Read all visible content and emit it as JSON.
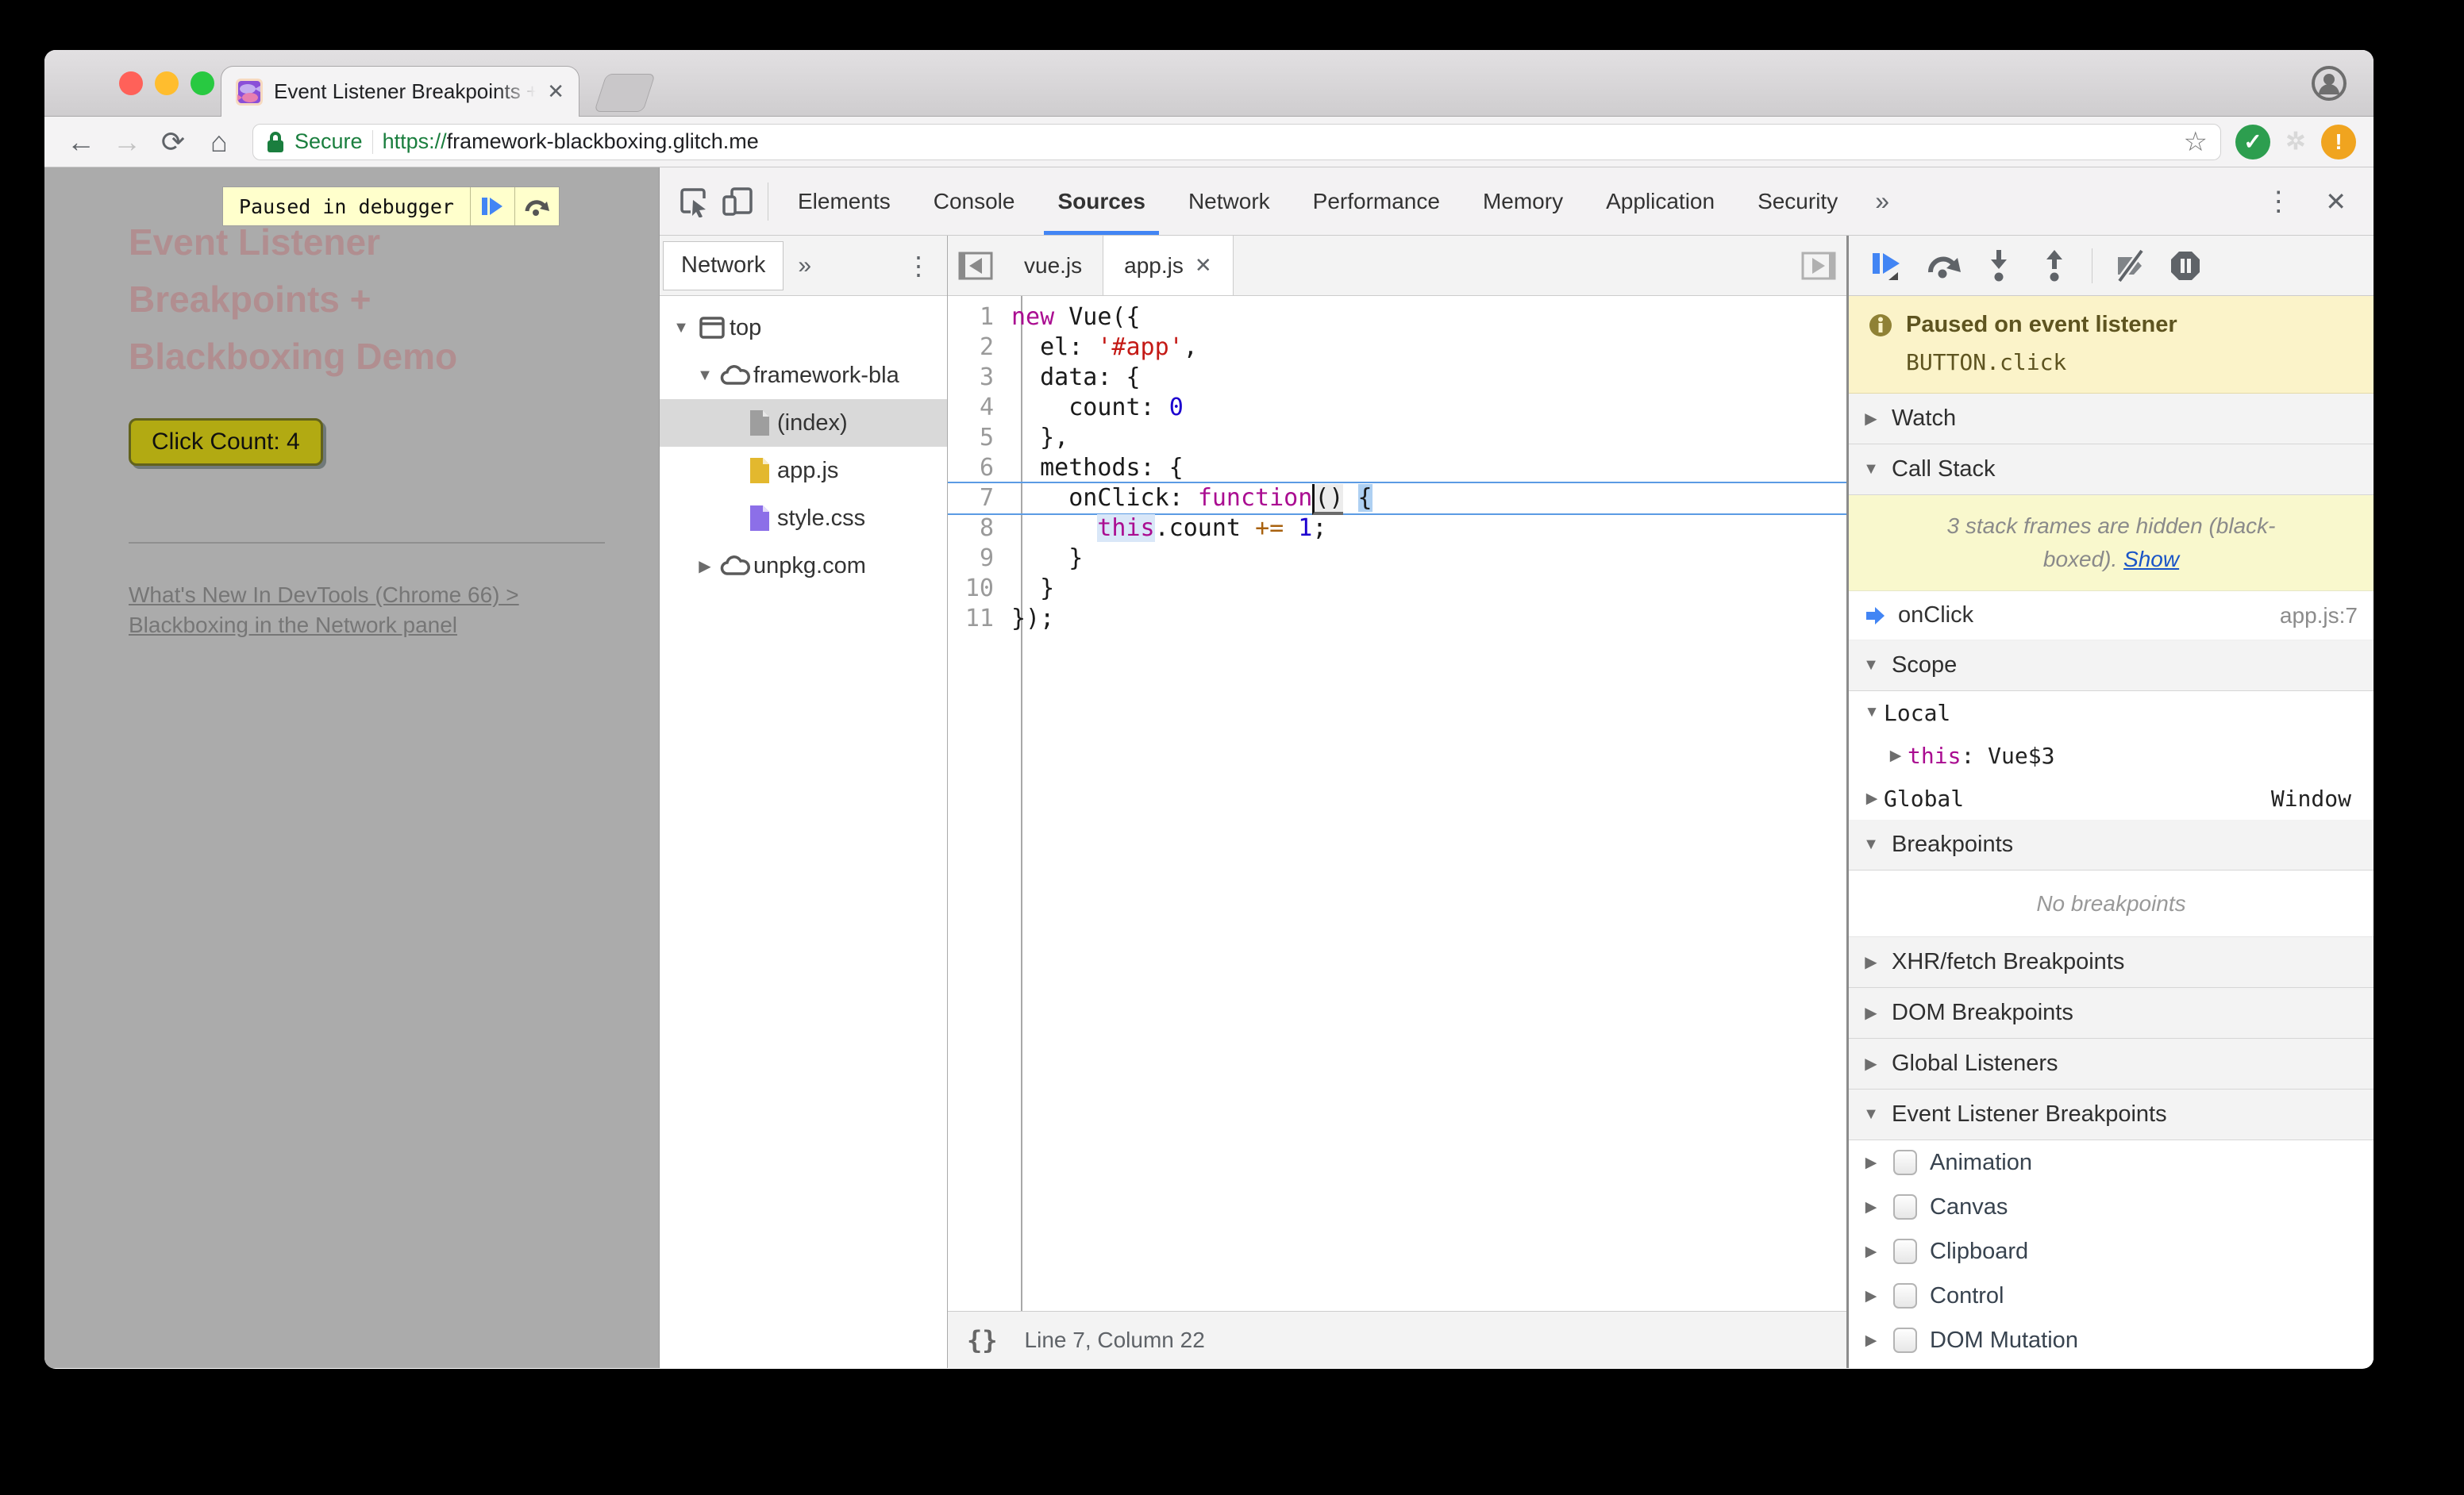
{
  "colors": {
    "accent_blue": "#4285f4",
    "exec_blue": "#5b9be4",
    "selection_blue": "#aed0f2",
    "token_hl_blue": "#d9e7f8",
    "paren_box_gray": "#ececec",
    "kw": "#aa0d91",
    "str": "#c41a16",
    "num": "#1c00cf",
    "op": "#a8610e",
    "paused_banner_bg": "#fbf3c9",
    "paused_banner_text": "#5e5420",
    "hidden_frames_bg": "#f9f8cd",
    "link_blue": "#1a55c7",
    "secure_green": "#1a7e3e",
    "page_bg": "#ababab",
    "page_title": "#b18e90",
    "page_button_bg": "#b2aa12",
    "ok_green": "#2d9e4f",
    "warn_orange": "#f0a41f"
  },
  "titlebar": {
    "tab_title": "Event Listener Breakpoints + B",
    "close_glyph": "✕"
  },
  "toolbar": {
    "secure_label": "Secure",
    "url_scheme": "https://",
    "url_host": "framework-blackboxing.glitch.me"
  },
  "page": {
    "paused_bar_label": "Paused in debugger",
    "title": "Event Listener\nBreakpoints +\nBlackboxing Demo",
    "button_label": "Click Count: 4",
    "link_text": "What's New In DevTools (Chrome 66) >\nBlackboxing in the Network panel"
  },
  "devtools": {
    "tabs": [
      {
        "label": "Elements",
        "active": false
      },
      {
        "label": "Console",
        "active": false
      },
      {
        "label": "Sources",
        "active": true
      },
      {
        "label": "Network",
        "active": false
      },
      {
        "label": "Performance",
        "active": false
      },
      {
        "label": "Memory",
        "active": false
      },
      {
        "label": "Application",
        "active": false
      },
      {
        "label": "Security",
        "active": false
      }
    ],
    "more_tabs_glyph": "»",
    "menu_glyph": "⋮",
    "close_glyph": "✕",
    "navigator": {
      "tab_label": "Network",
      "more_glyph": "»",
      "menu_glyph": "⋮",
      "tree": [
        {
          "indent": 0,
          "arrow": "▼",
          "icon": "frame",
          "label": "top",
          "selected": false
        },
        {
          "indent": 1,
          "arrow": "▼",
          "icon": "cloud",
          "label": "framework-bla",
          "selected": false
        },
        {
          "indent": 2,
          "arrow": "",
          "icon": "file-gray",
          "label": "(index)",
          "selected": true
        },
        {
          "indent": 2,
          "arrow": "",
          "icon": "file-yellow",
          "label": "app.js",
          "selected": false
        },
        {
          "indent": 2,
          "arrow": "",
          "icon": "file-purple",
          "label": "style.css",
          "selected": false
        },
        {
          "indent": 1,
          "arrow": "▶",
          "icon": "cloud",
          "label": "unpkg.com",
          "selected": false
        }
      ]
    },
    "editor": {
      "tabs": [
        {
          "label": "vue.js",
          "active": false,
          "closable": false
        },
        {
          "label": "app.js",
          "active": true,
          "closable": true
        }
      ],
      "close_glyph": "✕",
      "status": "Line 7, Column 22",
      "code": [
        {
          "n": "1",
          "exec": false,
          "tokens": [
            {
              "t": "new",
              "c": "kw"
            },
            {
              "t": " Vue({",
              "c": "pl"
            }
          ]
        },
        {
          "n": "2",
          "exec": false,
          "tokens": [
            {
              "t": "  el: ",
              "c": "pl"
            },
            {
              "t": "'#app'",
              "c": "str"
            },
            {
              "t": ",",
              "c": "pl"
            }
          ]
        },
        {
          "n": "3",
          "exec": false,
          "tokens": [
            {
              "t": "  data: {",
              "c": "pl"
            }
          ]
        },
        {
          "n": "4",
          "exec": false,
          "tokens": [
            {
              "t": "    count: ",
              "c": "pl"
            },
            {
              "t": "0",
              "c": "num"
            }
          ]
        },
        {
          "n": "5",
          "exec": false,
          "tokens": [
            {
              "t": "  },",
              "c": "pl"
            }
          ]
        },
        {
          "n": "6",
          "exec": false,
          "tokens": [
            {
              "t": "  methods: {",
              "c": "pl"
            }
          ]
        },
        {
          "n": "7",
          "exec": true,
          "tokens": [
            {
              "t": "    onClick: ",
              "c": "pl"
            },
            {
              "t": "function",
              "c": "kw"
            },
            {
              "t": "()",
              "c": "parenbox"
            },
            {
              "t": " ",
              "c": "pl"
            },
            {
              "t": "{",
              "c": "selbox"
            }
          ]
        },
        {
          "n": "8",
          "exec": false,
          "tokens": [
            {
              "t": "      ",
              "c": "pl"
            },
            {
              "t": "this",
              "c": "kw tokhl"
            },
            {
              "t": ".count ",
              "c": "pl"
            },
            {
              "t": "+=",
              "c": "op"
            },
            {
              "t": " ",
              "c": "pl"
            },
            {
              "t": "1",
              "c": "num"
            },
            {
              "t": ";",
              "c": "pl"
            }
          ]
        },
        {
          "n": "9",
          "exec": false,
          "tokens": [
            {
              "t": "    }",
              "c": "pl"
            }
          ]
        },
        {
          "n": "10",
          "exec": false,
          "tokens": [
            {
              "t": "  }",
              "c": "pl"
            }
          ]
        },
        {
          "n": "11",
          "exec": false,
          "tokens": [
            {
              "t": "});",
              "c": "pl"
            }
          ]
        }
      ]
    },
    "debugger": {
      "paused_title": "Paused on event listener",
      "paused_detail": "BUTTON.click",
      "watch_label": "Watch",
      "call_stack_label": "Call Stack",
      "hidden_frames_text": "3 stack frames are hidden (black-\nboxed). ",
      "show_label": "Show",
      "frame_name": "onClick",
      "frame_location": "app.js:7",
      "scope_label": "Scope",
      "local_label": "Local",
      "this_name": "this",
      "this_value": ": Vue$3",
      "global_label": "Global",
      "global_value": "Window",
      "breakpoints_label": "Breakpoints",
      "no_breakpoints": "No breakpoints",
      "xhr_label": "XHR/fetch Breakpoints",
      "dom_label": "DOM Breakpoints",
      "global_listeners_label": "Global Listeners",
      "elb_label": "Event Listener Breakpoints",
      "event_categories": [
        "Animation",
        "Canvas",
        "Clipboard",
        "Control",
        "DOM Mutation"
      ]
    }
  }
}
